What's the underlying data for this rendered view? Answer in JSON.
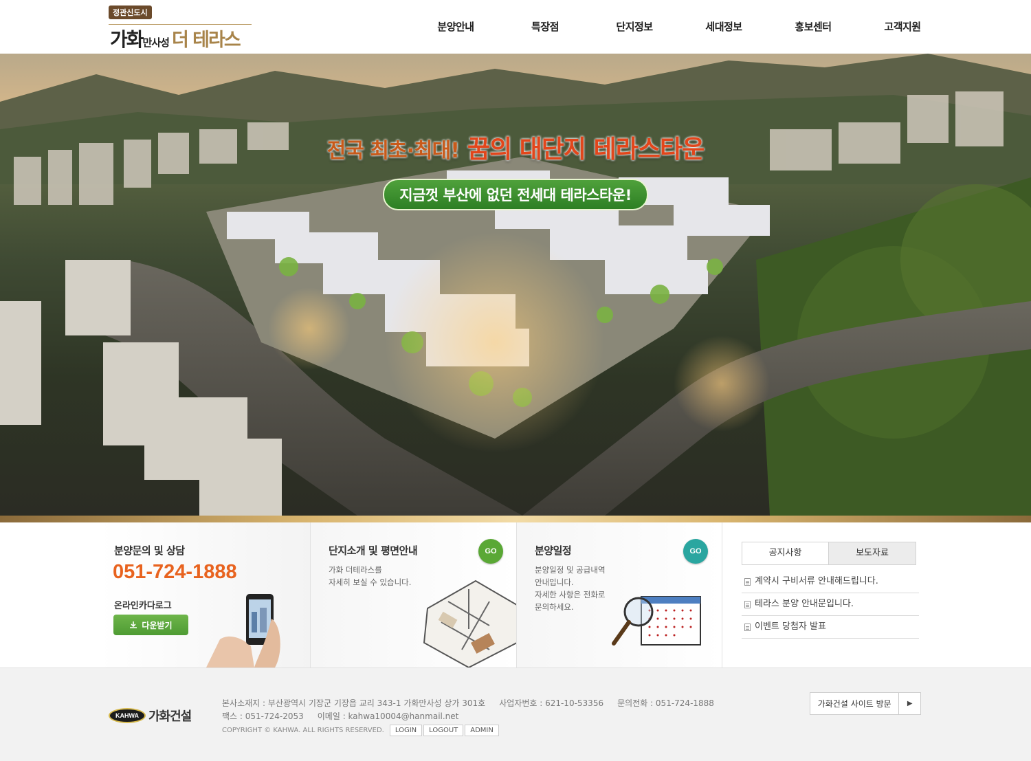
{
  "header": {
    "logo_badge": "정관신도시",
    "logo_brand": "가화",
    "logo_sub": "만사성",
    "logo_name": "더 테라스",
    "nav": [
      "분양안내",
      "특장점",
      "단지정보",
      "세대정보",
      "홍보센터",
      "고객지원"
    ]
  },
  "hero": {
    "headline_a": "전국 최초·최대!",
    "headline_b": "꿈의 대단지 테라스타운",
    "subline": "지금껏 부산에 없던 전세대 테라스타운!"
  },
  "panels": {
    "consult": {
      "title": "분양문의 및 상담",
      "phone": "051-724-1888",
      "catalog_label": "온라인카다로그",
      "download_label": "다운받기"
    },
    "complex": {
      "title": "단지소개 및 평면안내",
      "desc_line1": "가화 더테라스를",
      "desc_line2": "자세히 보실 수 있습니다.",
      "go_label": "GO"
    },
    "schedule": {
      "title": "분양일정",
      "desc_line1": "분양일정 및 공급내역",
      "desc_line2": "안내입니다.",
      "desc_line3": "자세한 사항은 전화로",
      "desc_line4": "문의하세요.",
      "go_label": "GO"
    },
    "notice": {
      "tabs": [
        "공지사항",
        "보도자료"
      ],
      "items": [
        "계약시 구비서류 안내해드립니다.",
        "테라스 분양 안내문입니다.",
        "이벤트 당첨자 발표"
      ]
    }
  },
  "footer": {
    "logo_mark": "KAHWA",
    "logo_text": "가화건설",
    "address": "본사소재지 : 부산광역시 기장군 기장읍 교리 343-1 가화만사성 상가 301호",
    "biz_no": "사업자번호 : 621-10-53356",
    "inquiry": "문의전화 : 051-724-1888",
    "fax": "팩스 : 051-724-2053",
    "email": "이메일 : kahwa10004@hanmail.net",
    "copyright": "COPYRIGHT © KAHWA. ALL RIGHTS RESERVED.",
    "admin_buttons": [
      "LOGIN",
      "LOGOUT",
      "ADMIN"
    ],
    "visit_label": "가화건설 사이트 방문"
  },
  "colors": {
    "accent_orange": "#e8631f",
    "brand_green": "#5aa835",
    "teal": "#2aa6a0",
    "gold": "#a8844a"
  }
}
